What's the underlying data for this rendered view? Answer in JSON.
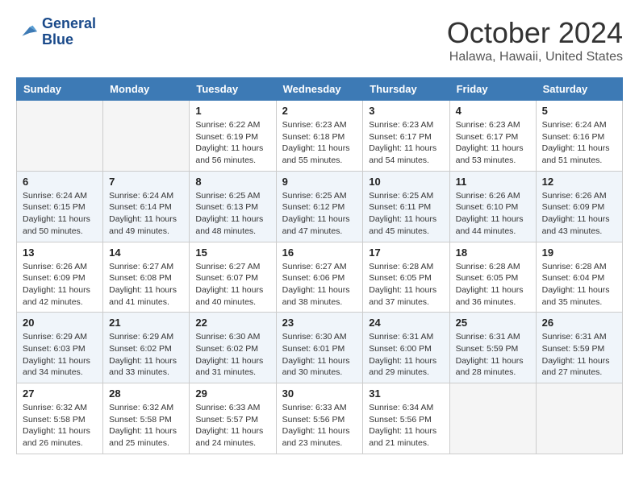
{
  "header": {
    "logo_line1": "General",
    "logo_line2": "Blue",
    "month_title": "October 2024",
    "location": "Halawa, Hawaii, United States"
  },
  "weekdays": [
    "Sunday",
    "Monday",
    "Tuesday",
    "Wednesday",
    "Thursday",
    "Friday",
    "Saturday"
  ],
  "weeks": [
    [
      {
        "day": "",
        "empty": true
      },
      {
        "day": "",
        "empty": true
      },
      {
        "day": "1",
        "sunrise": "6:22 AM",
        "sunset": "6:19 PM",
        "daylight": "11 hours and 56 minutes."
      },
      {
        "day": "2",
        "sunrise": "6:23 AM",
        "sunset": "6:18 PM",
        "daylight": "11 hours and 55 minutes."
      },
      {
        "day": "3",
        "sunrise": "6:23 AM",
        "sunset": "6:17 PM",
        "daylight": "11 hours and 54 minutes."
      },
      {
        "day": "4",
        "sunrise": "6:23 AM",
        "sunset": "6:17 PM",
        "daylight": "11 hours and 53 minutes."
      },
      {
        "day": "5",
        "sunrise": "6:24 AM",
        "sunset": "6:16 PM",
        "daylight": "11 hours and 51 minutes."
      }
    ],
    [
      {
        "day": "6",
        "sunrise": "6:24 AM",
        "sunset": "6:15 PM",
        "daylight": "11 hours and 50 minutes."
      },
      {
        "day": "7",
        "sunrise": "6:24 AM",
        "sunset": "6:14 PM",
        "daylight": "11 hours and 49 minutes."
      },
      {
        "day": "8",
        "sunrise": "6:25 AM",
        "sunset": "6:13 PM",
        "daylight": "11 hours and 48 minutes."
      },
      {
        "day": "9",
        "sunrise": "6:25 AM",
        "sunset": "6:12 PM",
        "daylight": "11 hours and 47 minutes."
      },
      {
        "day": "10",
        "sunrise": "6:25 AM",
        "sunset": "6:11 PM",
        "daylight": "11 hours and 45 minutes."
      },
      {
        "day": "11",
        "sunrise": "6:26 AM",
        "sunset": "6:10 PM",
        "daylight": "11 hours and 44 minutes."
      },
      {
        "day": "12",
        "sunrise": "6:26 AM",
        "sunset": "6:09 PM",
        "daylight": "11 hours and 43 minutes."
      }
    ],
    [
      {
        "day": "13",
        "sunrise": "6:26 AM",
        "sunset": "6:09 PM",
        "daylight": "11 hours and 42 minutes."
      },
      {
        "day": "14",
        "sunrise": "6:27 AM",
        "sunset": "6:08 PM",
        "daylight": "11 hours and 41 minutes."
      },
      {
        "day": "15",
        "sunrise": "6:27 AM",
        "sunset": "6:07 PM",
        "daylight": "11 hours and 40 minutes."
      },
      {
        "day": "16",
        "sunrise": "6:27 AM",
        "sunset": "6:06 PM",
        "daylight": "11 hours and 38 minutes."
      },
      {
        "day": "17",
        "sunrise": "6:28 AM",
        "sunset": "6:05 PM",
        "daylight": "11 hours and 37 minutes."
      },
      {
        "day": "18",
        "sunrise": "6:28 AM",
        "sunset": "6:05 PM",
        "daylight": "11 hours and 36 minutes."
      },
      {
        "day": "19",
        "sunrise": "6:28 AM",
        "sunset": "6:04 PM",
        "daylight": "11 hours and 35 minutes."
      }
    ],
    [
      {
        "day": "20",
        "sunrise": "6:29 AM",
        "sunset": "6:03 PM",
        "daylight": "11 hours and 34 minutes."
      },
      {
        "day": "21",
        "sunrise": "6:29 AM",
        "sunset": "6:02 PM",
        "daylight": "11 hours and 33 minutes."
      },
      {
        "day": "22",
        "sunrise": "6:30 AM",
        "sunset": "6:02 PM",
        "daylight": "11 hours and 31 minutes."
      },
      {
        "day": "23",
        "sunrise": "6:30 AM",
        "sunset": "6:01 PM",
        "daylight": "11 hours and 30 minutes."
      },
      {
        "day": "24",
        "sunrise": "6:31 AM",
        "sunset": "6:00 PM",
        "daylight": "11 hours and 29 minutes."
      },
      {
        "day": "25",
        "sunrise": "6:31 AM",
        "sunset": "5:59 PM",
        "daylight": "11 hours and 28 minutes."
      },
      {
        "day": "26",
        "sunrise": "6:31 AM",
        "sunset": "5:59 PM",
        "daylight": "11 hours and 27 minutes."
      }
    ],
    [
      {
        "day": "27",
        "sunrise": "6:32 AM",
        "sunset": "5:58 PM",
        "daylight": "11 hours and 26 minutes."
      },
      {
        "day": "28",
        "sunrise": "6:32 AM",
        "sunset": "5:58 PM",
        "daylight": "11 hours and 25 minutes."
      },
      {
        "day": "29",
        "sunrise": "6:33 AM",
        "sunset": "5:57 PM",
        "daylight": "11 hours and 24 minutes."
      },
      {
        "day": "30",
        "sunrise": "6:33 AM",
        "sunset": "5:56 PM",
        "daylight": "11 hours and 23 minutes."
      },
      {
        "day": "31",
        "sunrise": "6:34 AM",
        "sunset": "5:56 PM",
        "daylight": "11 hours and 21 minutes."
      },
      {
        "day": "",
        "empty": true
      },
      {
        "day": "",
        "empty": true
      }
    ]
  ]
}
